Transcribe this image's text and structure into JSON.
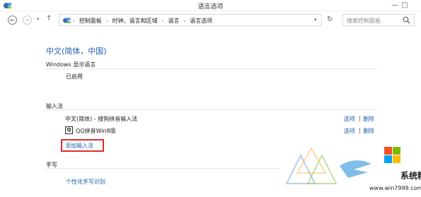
{
  "window": {
    "title": "语言选项",
    "minimize": "—",
    "maximize": "□"
  },
  "nav": {
    "back": "←",
    "forward": "→",
    "dropdown": "▾",
    "up": "↑",
    "refresh": "↻"
  },
  "breadcrumb": {
    "items": [
      "控制面板",
      "时钟、语言和区域",
      "语言",
      "语言选项"
    ],
    "separator": "›"
  },
  "search": {
    "placeholder": "搜索控制面板"
  },
  "content": {
    "language_title": "中文(简体，中国)",
    "display_language_section": "Windows 显示语言",
    "display_language_status": "已启用",
    "input_method_section": "输入法",
    "input_methods": [
      {
        "name": "中文(简体) - 搜狗拼音输入法",
        "options": "选项",
        "separator": "|",
        "remove": "删除"
      },
      {
        "name": "QQ拼音Win8版",
        "icon_text": "Q",
        "options": "选项",
        "separator": "|",
        "remove": "删除"
      }
    ],
    "add_input_method": "添加输入法",
    "handwriting_section": "手写",
    "handwriting_link": "个性化手写识别"
  },
  "watermark": {
    "brand": "系统粉",
    "url": "www.win7999.com"
  },
  "colors": {
    "link": "#1e5fa8",
    "highlight_box": "#d9302a"
  }
}
